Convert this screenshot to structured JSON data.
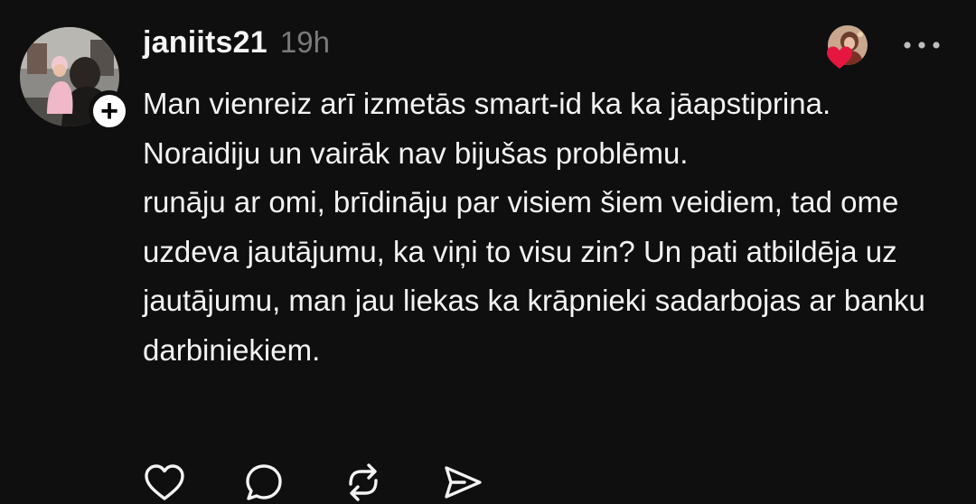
{
  "post": {
    "username": "janiits21",
    "timestamp": "19h",
    "paragraphs": [
      "Man vienreiz arī izmetās smart-id ka ka jāapstiprina. Noraidiju un vairāk nav bijušas problēmu.",
      "runāju ar omi, brīdināju par visiem šiem veidiem, tad ome uzdeva jautājumu, ka viņi to visu zin? Un pati atbildēja uz jautājumu, man jau liekas ka krāpnieki sadarbojas ar banku darbiniekiem."
    ]
  },
  "icons": {
    "follow": "plus-icon",
    "liked_by": "heart-icon",
    "more": "more-options-icon",
    "actions": [
      "like-icon",
      "comment-icon",
      "repost-icon",
      "share-icon"
    ]
  },
  "colors": {
    "background": "#0f0f0f",
    "text": "#f3f3f3",
    "muted": "#7a7a7a",
    "heart": "#e5163f"
  }
}
